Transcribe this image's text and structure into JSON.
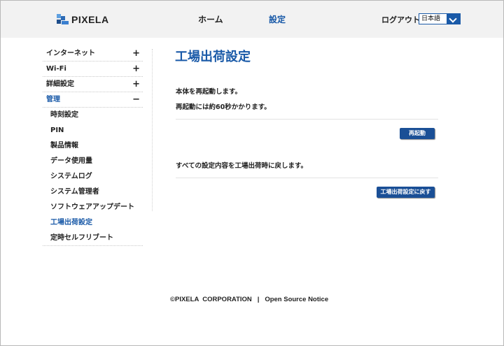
{
  "header": {
    "logo_text": "PIXELA",
    "nav_home": "ホーム",
    "nav_settings": "設定",
    "logout": "ログアウト",
    "language": {
      "selected": "日本語"
    }
  },
  "sidebar": {
    "sections": [
      {
        "label": "インターネット",
        "sign": "+"
      },
      {
        "label": "Wi-Fi",
        "sign": "+"
      },
      {
        "label": "詳細設定",
        "sign": "+"
      },
      {
        "label": "管理",
        "sign": "−"
      }
    ],
    "sub_items": [
      {
        "label": "時刻設定"
      },
      {
        "label": "PIN"
      },
      {
        "label": "製品情報"
      },
      {
        "label": "データ使用量"
      },
      {
        "label": "システムログ"
      },
      {
        "label": "システム管理者"
      },
      {
        "label": "ソフトウェアアップデート"
      },
      {
        "label": "工場出荷設定"
      },
      {
        "label": "定時セルフリブート"
      }
    ]
  },
  "main": {
    "title": "工場出荷設定",
    "reboot_text_1": "本体を再起動します。",
    "reboot_text_2": "再起動には約60秒かかります。",
    "reboot_button": "再起動",
    "reset_text": "すべての設定内容を工場出荷時に戻します。",
    "reset_button": "工場出荷設定に戻す"
  },
  "footer": {
    "copyright": "©PIXELA  CORPORATION",
    "separator": "|",
    "open_source": "Open Source Notice"
  },
  "colors": {
    "accent": "#1a5aa8",
    "button": "#1a4f96",
    "header_bg": "#f2f2f2"
  }
}
